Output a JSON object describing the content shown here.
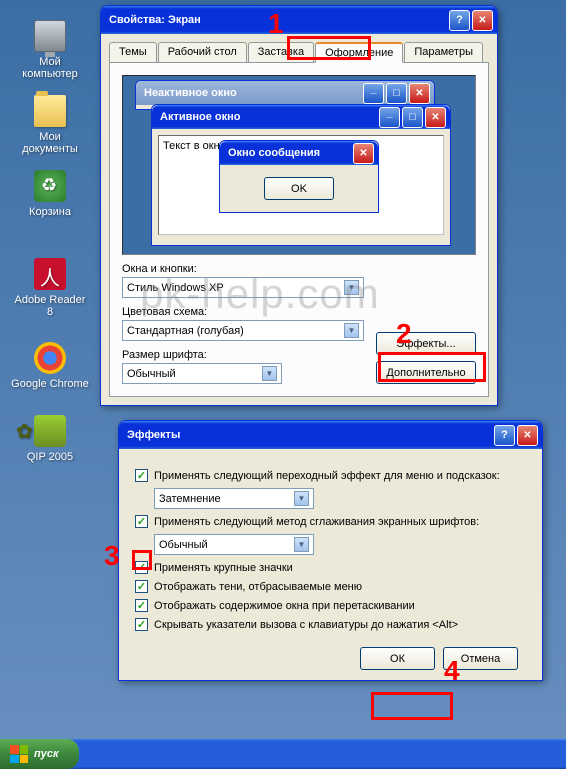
{
  "desktop": {
    "icons": [
      {
        "label": "Мой\nкомпьютер"
      },
      {
        "label": "Мои\nдокументы"
      },
      {
        "label": "Корзина"
      },
      {
        "label": "Adobe Reader\n8"
      },
      {
        "label": "Google Chrome"
      },
      {
        "label": "QIP 2005"
      }
    ]
  },
  "taskbar": {
    "start": "пуск"
  },
  "watermark": "pk-help.com",
  "props_window": {
    "title": "Свойства: Экран",
    "tabs": [
      "Темы",
      "Рабочий стол",
      "Заставка",
      "Оформление",
      "Параметры"
    ],
    "preview": {
      "inactive_title": "Неактивное окно",
      "active_title": "Активное окно",
      "text_in_window": "Текст в окне",
      "msgbox_title": "Окно сообщения",
      "msgbox_ok": "OK"
    },
    "labels": {
      "windows_buttons": "Окна и кнопки:",
      "color_scheme": "Цветовая схема:",
      "font_size": "Размер шрифта:"
    },
    "selects": {
      "windows_buttons": "Стиль Windows XP",
      "color_scheme": "Стандартная (голубая)",
      "font_size": "Обычный"
    },
    "buttons": {
      "effects": "Эффекты...",
      "advanced": "Дополнительно"
    }
  },
  "effects_dialog": {
    "title": "Эффекты",
    "check1": "Применять следующий переходный эффект для меню и подсказок:",
    "select1": "Затемнение",
    "check2": "Применять следующий метод сглаживания экранных шрифтов:",
    "select2": "Обычный",
    "check3": "Применять крупные значки",
    "check4": "Отображать тени, отбрасываемые меню",
    "check5": "Отображать содержимое окна при перетаскивании",
    "check6": "Скрывать указатели вызова с клавиатуры до нажатия <Alt>",
    "ok": "ОК",
    "cancel": "Отмена"
  },
  "annotations": {
    "n1": "1",
    "n2": "2",
    "n3": "3",
    "n4": "4"
  }
}
